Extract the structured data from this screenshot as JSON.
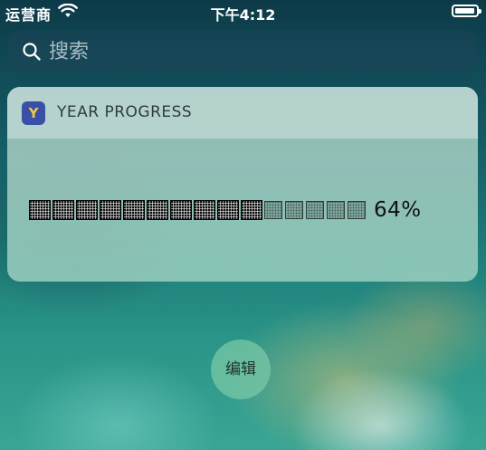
{
  "status_bar": {
    "carrier": "运营商",
    "time": "下午4:12",
    "wifi_icon": "wifi-icon",
    "battery_icon": "battery-icon",
    "battery_level": 0.95
  },
  "search": {
    "placeholder": "搜索",
    "value": "",
    "icon": "search-icon"
  },
  "widget": {
    "app_icon_letter": "Y",
    "app_icon_colors": {
      "background": "#3a4fa6",
      "letter": "#f2c84b"
    },
    "title": "YEAR PROGRESS",
    "progress_percent_label": "64%",
    "progress_value": 0.64,
    "blocks_filled": 10,
    "blocks_total": 15
  },
  "edit_button": {
    "label": "编辑"
  }
}
